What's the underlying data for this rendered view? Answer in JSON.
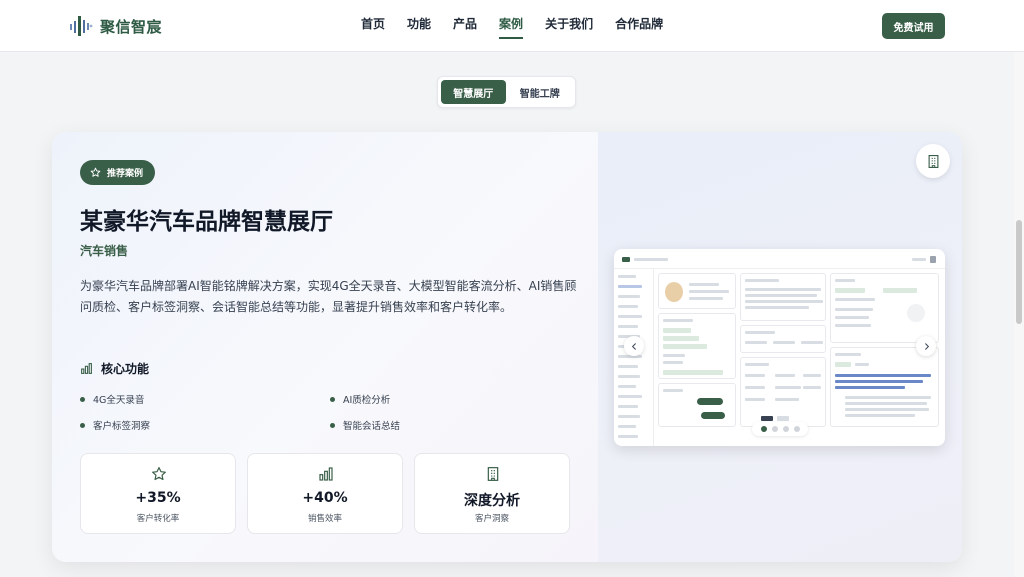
{
  "header": {
    "brand": "聚信智宸",
    "nav": [
      "首页",
      "功能",
      "产品",
      "案例",
      "关于我们",
      "合作品牌"
    ],
    "active_nav": "案例",
    "cta": "免费试用"
  },
  "tabs": [
    {
      "label": "智慧展厅",
      "active": true
    },
    {
      "label": "智能工牌",
      "active": false
    }
  ],
  "case": {
    "badge": "推荐案例",
    "title": "某豪华汽车品牌智慧展厅",
    "subtitle": "汽车销售",
    "description": "为豪华汽车品牌部署AI智能铭牌解决方案，实现4G全天录音、大模型智能客流分析、AI销售顾问质检、客户标签洞察、会话智能总结等功能，显著提升销售效率和客户转化率。",
    "features_title": "核心功能",
    "features": [
      "4G全天录音",
      "AI质检分析",
      "客户标签洞察",
      "智能会话总结"
    ],
    "stats": [
      {
        "icon": "star-icon",
        "value": "+35%",
        "label": "客户转化率"
      },
      {
        "icon": "bar-chart-icon",
        "value": "+40%",
        "label": "销售效率"
      },
      {
        "icon": "building-icon",
        "value": "深度分析",
        "label": "客户洞察"
      }
    ]
  },
  "carousel": {
    "slides": 4,
    "current": 1
  },
  "colors": {
    "primary": "#3a5f48",
    "text": "#111827",
    "muted": "#4b5563"
  }
}
